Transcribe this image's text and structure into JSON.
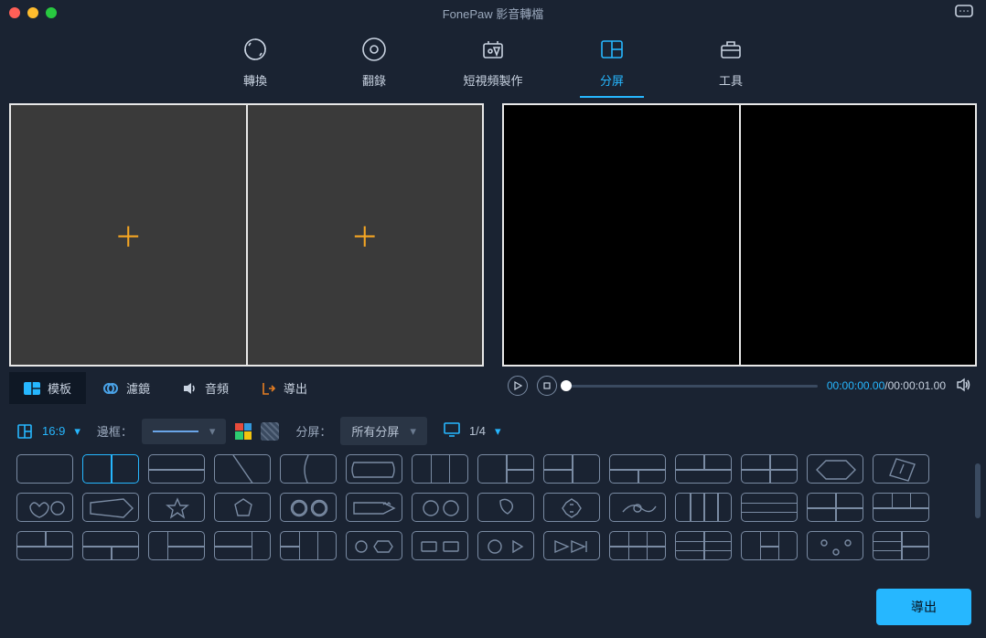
{
  "app": {
    "title": "FonePaw 影音轉檔"
  },
  "mainTabs": [
    {
      "label": "轉換"
    },
    {
      "label": "翻錄"
    },
    {
      "label": "短視頻製作"
    },
    {
      "label": "分屏"
    },
    {
      "label": "工具"
    }
  ],
  "leftTabs": [
    {
      "label": "模板"
    },
    {
      "label": "濾鏡"
    },
    {
      "label": "音頻"
    },
    {
      "label": "導出"
    }
  ],
  "playback": {
    "current": "00:00:00.00",
    "total": "00:00:01.00"
  },
  "options": {
    "aspect": "16:9",
    "borderLabel": "邊框：",
    "splitLabel": "分屏：",
    "splitValue": "所有分屏",
    "screenLabel": "1/4"
  },
  "footer": {
    "export": "導出"
  },
  "colors": {
    "accent": "#26b7ff",
    "plus": "#f5a623"
  }
}
